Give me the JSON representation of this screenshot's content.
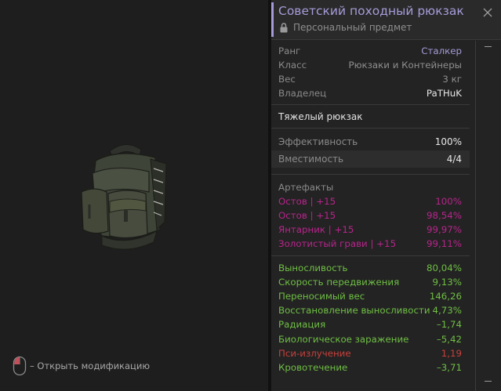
{
  "item": {
    "title": "Советский походный рюкзак",
    "subtitle": "Персональный предмет"
  },
  "info": [
    {
      "label": "Ранг",
      "value": "Сталкер",
      "tone": "purple"
    },
    {
      "label": "Класс",
      "value": "Рюкзаки и Контейнеры",
      "tone": "grey"
    },
    {
      "label": "Вес",
      "value": "3 кг",
      "tone": "grey"
    },
    {
      "label": "Владелец",
      "value": "PaTHuK",
      "tone": "white"
    }
  ],
  "item_type": "Тяжелый рюкзак",
  "stats": [
    {
      "label": "Эффективность",
      "value": "100%"
    },
    {
      "label": "Вместимость",
      "value": "4/4"
    }
  ],
  "artifacts": {
    "header": "Артефакты",
    "items": [
      {
        "name": "Остов | +15",
        "value": "100%"
      },
      {
        "name": "Остов | +15",
        "value": "98,54%"
      },
      {
        "name": "Янтарник | +15",
        "value": "99,97%"
      },
      {
        "name": "Золотистый грави | +15",
        "value": "99,11%"
      }
    ]
  },
  "effects": [
    {
      "name": "Выносливость",
      "value": "80,04%",
      "tone": "green"
    },
    {
      "name": "Скорость передвижения",
      "value": "9,13%",
      "tone": "green"
    },
    {
      "name": "Переносимый вес",
      "value": "146,26",
      "tone": "green"
    },
    {
      "name": "Восстановление выносливости",
      "value": "4,73%",
      "tone": "green"
    },
    {
      "name": "Радиация",
      "value": "–1,74",
      "tone": "green"
    },
    {
      "name": "Биологическое заражение",
      "value": "–5,42",
      "tone": "green"
    },
    {
      "name": "Пси-излучение",
      "value": "1,19",
      "tone": "red"
    },
    {
      "name": "Кровотечение",
      "value": "–3,71",
      "tone": "green"
    }
  ],
  "hint": {
    "text": "– Открыть модификацию"
  },
  "icons": {
    "close": "close-icon",
    "lock": "lock-icon",
    "mouse": "mouse-icon",
    "item": "backpack-icon"
  },
  "colors": {
    "accent": "#a69bd8",
    "artifact": "#b8248c",
    "positive": "#6fbf44",
    "negative": "#c8403c"
  }
}
